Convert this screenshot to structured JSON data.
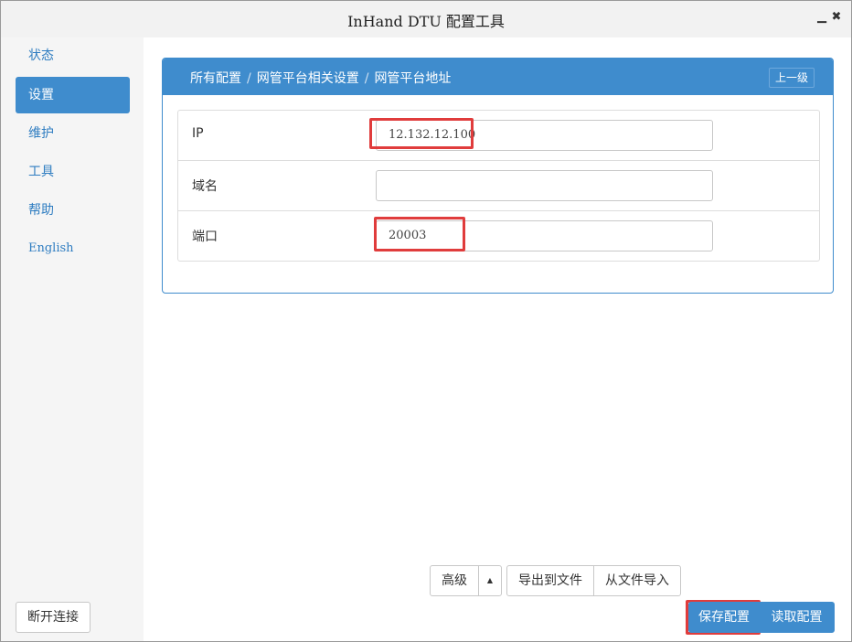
{
  "window": {
    "title": "InHand DTU 配置工具",
    "minimize_icon": "minimize-icon",
    "close_icon": "close-icon"
  },
  "sidebar": {
    "items": [
      {
        "label": "状态"
      },
      {
        "label": "设置",
        "active": true
      },
      {
        "label": "维护"
      },
      {
        "label": "工具"
      },
      {
        "label": "帮助"
      },
      {
        "label": "English"
      }
    ],
    "disconnect_label": "断开连接"
  },
  "panel": {
    "breadcrumb": [
      "所有配置",
      "网管平台相关设置",
      "网管平台地址"
    ],
    "breadcrumb_sep": "/",
    "up_label": "上一级",
    "fields": [
      {
        "label": "IP",
        "value": "12.132.12.100"
      },
      {
        "label": "域名",
        "value": ""
      },
      {
        "label": "端口",
        "value": "20003"
      }
    ]
  },
  "footer": {
    "advanced_label": "高级",
    "advanced_caret": "▲",
    "export_label": "导出到文件",
    "import_label": "从文件导入",
    "save_label": "保存配置",
    "read_label": "读取配置"
  },
  "colors": {
    "accent": "#3f8ccd",
    "highlight": "#e03c3c"
  }
}
